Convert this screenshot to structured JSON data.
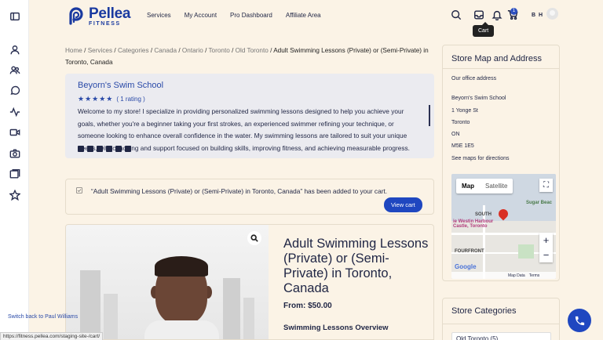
{
  "brand": {
    "name": "Pellea",
    "tagline": "FITNESS",
    "primary": "#1f47c0",
    "accent": "#2a4aa8"
  },
  "nav": [
    "Services",
    "My Account",
    "Pro Dashboard",
    "Affiliate Area"
  ],
  "header": {
    "initials": "B H",
    "cart_count": "1",
    "cart_tooltip": "Cart"
  },
  "breadcrumb": {
    "items": [
      "Home",
      "Services",
      "Categories",
      "Canada",
      "Ontario",
      "Toronto",
      "Old Toronto"
    ],
    "separator": "/",
    "current": "Adult Swimming Lessons (Private) or (Semi-Private) in Toronto, Canada"
  },
  "store": {
    "name": "Beyorn's Swim School",
    "stars": "★★★★★",
    "rating_text": "( 1 rating )",
    "description": "Welcome to my store! I specialize in providing personalized swimming lessons designed to help you achieve your goals, whether you're a beginner taking your first strokes, an experienced swimmer refining your technique, or someone looking to enhance overall confidence in the water. My swimming lessons are tailored to suit your unique needs, with coaching and support focused on building skills, improving fitness, and achieving measurable progress. Each session is thoughtfully structured to ensure a safe, supportive, and results-driven experience. Consequently,",
    "socials": [
      "twitter-icon",
      "instagram-icon",
      "facebook-icon",
      "linkedin-icon",
      "youtube-icon",
      "pinterest-icon"
    ]
  },
  "notice": {
    "text": "“Adult Swimming Lessons (Private) or (Semi-Private) in Toronto, Canada” has been added to your cart.",
    "button": "View cart"
  },
  "product": {
    "title": "Adult Swimming Lessons (Private) or (Semi-Private) in Toronto, Canada",
    "price": "From: $50.00",
    "overview_heading": "Swimming Lessons Overview"
  },
  "store_map": {
    "title": "Store Map and Address",
    "office_label": "Our office address",
    "address_lines": [
      "Beyorn's Swim School",
      "1 Yonge St",
      "Toronto",
      "ON",
      "M5E 1E5"
    ],
    "directions_link": "See maps for directions",
    "map_tab_active": "Map",
    "map_tab_inactive": "Satellite",
    "map_labels": {
      "south": "SOUTH",
      "harbour": "ie Westin Harbour Castle, Toronto",
      "sugar": "Sugar Beac",
      "front": "FOURFRONT"
    },
    "footer": {
      "google": "Google",
      "data": "Map Data",
      "terms": "Terms"
    }
  },
  "categories": {
    "title": "Store Categories",
    "items": [
      "Old Toronto  (5)"
    ]
  },
  "footer": {
    "switch_back": "Switch back to Paul Williams",
    "status_url": "https://fitness.pellea.com/staging-site-/cart/"
  }
}
